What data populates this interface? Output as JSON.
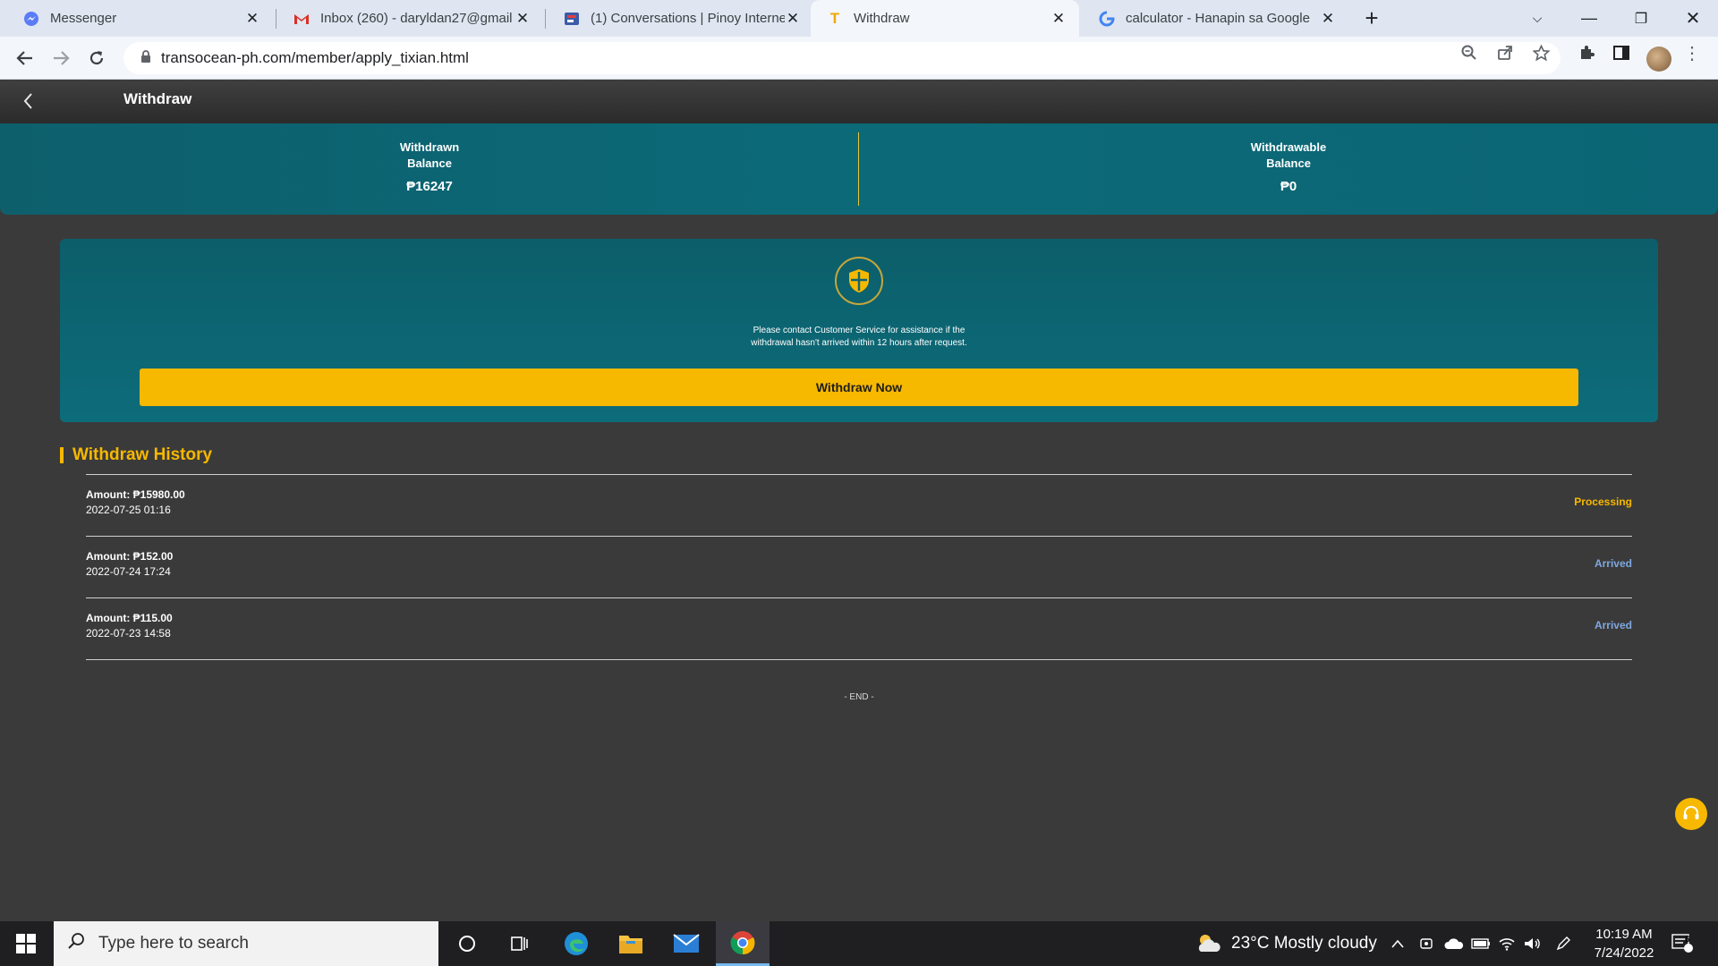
{
  "browser": {
    "tabs": [
      {
        "title": "Messenger",
        "icon": "messenger-icon"
      },
      {
        "title": "Inbox (260) - daryldan27@gmail",
        "icon": "gmail-icon"
      },
      {
        "title": "(1) Conversations | Pinoy Interne",
        "icon": "forum-icon"
      },
      {
        "title": "Withdraw",
        "icon": "site-icon",
        "active": true
      },
      {
        "title": "calculator - Hanapin sa Google",
        "icon": "google-icon"
      }
    ],
    "url": "transocean-ph.com/member/apply_tixian.html"
  },
  "header": {
    "title": "Withdraw"
  },
  "balances": {
    "withdrawn_label_1": "Withdrawn",
    "withdrawn_label_2": "Balance",
    "withdrawn_value": "₱16247",
    "withdrawable_label_1": "Withdrawable",
    "withdrawable_label_2": "Balance",
    "withdrawable_value": "₱0"
  },
  "notice": {
    "line1": "Please contact Customer Service for assistance if the",
    "line2": "withdrawal hasn't arrived within 12 hours after request.",
    "button": "Withdraw Now"
  },
  "history": {
    "title": "Withdraw History",
    "rows": [
      {
        "amount": "Amount: ₱15980.00",
        "date": "2022-07-25 01:16",
        "status": "Processing"
      },
      {
        "amount": "Amount: ₱152.00",
        "date": "2022-07-24 17:24",
        "status": "Arrived"
      },
      {
        "amount": "Amount: ₱115.00",
        "date": "2022-07-23 14:58",
        "status": "Arrived"
      }
    ],
    "end": "- END -"
  },
  "colors": {
    "accent": "#f7b800",
    "processing": "#f7b800",
    "arrived": "#7fa8e0",
    "teal": "#0c6a78"
  },
  "taskbar": {
    "search_placeholder": "Type here to search",
    "weather": "23°C  Mostly cloudy",
    "time": "10:19 AM",
    "date": "7/24/2022",
    "notification_count": "6"
  }
}
